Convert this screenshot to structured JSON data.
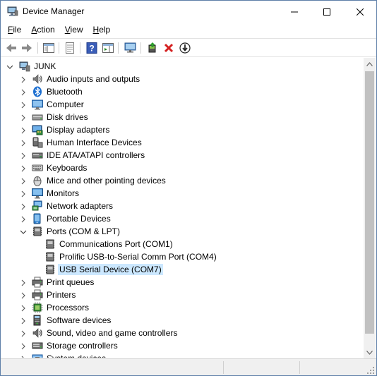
{
  "window": {
    "title": "Device Manager"
  },
  "menu": [
    {
      "label": "File",
      "accel": "F",
      "rest": "ile"
    },
    {
      "label": "Action",
      "accel": "A",
      "rest": "ction"
    },
    {
      "label": "View",
      "accel": "V",
      "rest": "iew"
    },
    {
      "label": "Help",
      "accel": "H",
      "rest": "elp"
    }
  ],
  "toolbar": [
    "back-icon",
    "forward-icon",
    "show-hide-console-tree-icon",
    "properties-icon",
    "help-icon",
    "show-action-pane-icon",
    "scan-hardware-icon",
    "update-driver-icon",
    "uninstall-device-icon",
    "disable-device-icon"
  ],
  "tree": {
    "root": "JUNK",
    "items": [
      {
        "label": "Audio inputs and outputs",
        "icon": "speaker-icon",
        "expanded": false
      },
      {
        "label": "Bluetooth",
        "icon": "bluetooth-icon",
        "expanded": false
      },
      {
        "label": "Computer",
        "icon": "computer-icon",
        "expanded": false
      },
      {
        "label": "Disk drives",
        "icon": "disk-drive-icon",
        "expanded": false
      },
      {
        "label": "Display adapters",
        "icon": "display-adapter-icon",
        "expanded": false
      },
      {
        "label": "Human Interface Devices",
        "icon": "hid-icon",
        "expanded": false
      },
      {
        "label": "IDE ATA/ATAPI controllers",
        "icon": "ide-controller-icon",
        "expanded": false
      },
      {
        "label": "Keyboards",
        "icon": "keyboard-icon",
        "expanded": false
      },
      {
        "label": "Mice and other pointing devices",
        "icon": "mouse-icon",
        "expanded": false
      },
      {
        "label": "Monitors",
        "icon": "monitor-icon",
        "expanded": false
      },
      {
        "label": "Network adapters",
        "icon": "network-adapter-icon",
        "expanded": false
      },
      {
        "label": "Portable Devices",
        "icon": "portable-device-icon",
        "expanded": false
      },
      {
        "label": "Ports (COM & LPT)",
        "icon": "port-icon",
        "expanded": true,
        "children": [
          {
            "label": "Communications Port (COM1)",
            "icon": "port-icon",
            "selected": false
          },
          {
            "label": "Prolific USB-to-Serial Comm Port (COM4)",
            "icon": "port-icon",
            "selected": false
          },
          {
            "label": "USB Serial Device (COM7)",
            "icon": "port-icon",
            "selected": true
          }
        ]
      },
      {
        "label": "Print queues",
        "icon": "printer-icon",
        "expanded": false
      },
      {
        "label": "Printers",
        "icon": "printer-icon",
        "expanded": false
      },
      {
        "label": "Processors",
        "icon": "processor-icon",
        "expanded": false
      },
      {
        "label": "Software devices",
        "icon": "software-device-icon",
        "expanded": false
      },
      {
        "label": "Sound, video and game controllers",
        "icon": "sound-icon",
        "expanded": false
      },
      {
        "label": "Storage controllers",
        "icon": "storage-controller-icon",
        "expanded": false
      },
      {
        "label": "System devices",
        "icon": "system-device-icon",
        "expanded": false
      }
    ]
  },
  "colors": {
    "selection": "#cce8ff",
    "titlebar_bg": "#ffffff",
    "window_border": "#5e7fa8",
    "scrollbar_bg": "#f0f0f0",
    "scrollbar_thumb": "#c1c1c1"
  }
}
